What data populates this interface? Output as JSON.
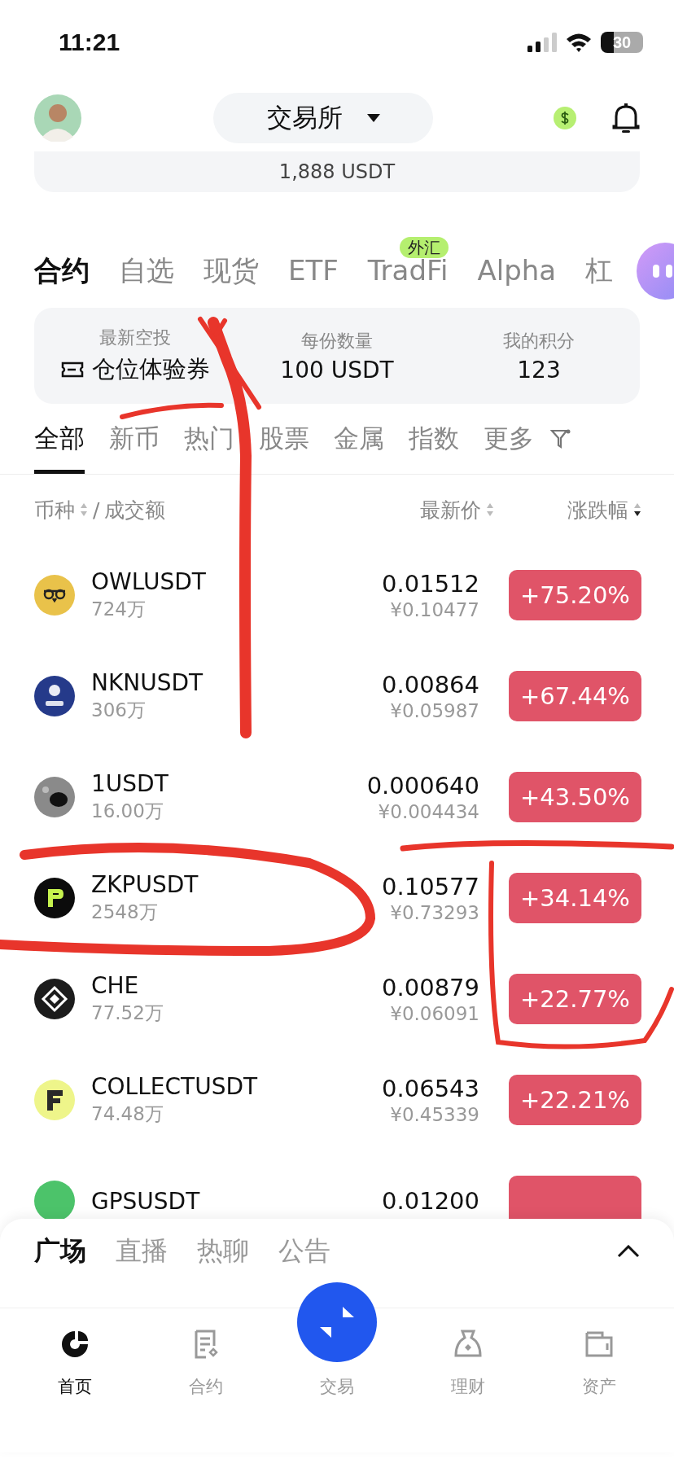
{
  "status_bar": {
    "time": "11:21",
    "battery": "30"
  },
  "header": {
    "exchange_selector": "交易所"
  },
  "balance_card": {
    "text": "1,888 USDT"
  },
  "market_tabs": [
    {
      "label": "合约",
      "selected": true
    },
    {
      "label": "自选",
      "selected": false
    },
    {
      "label": "现货",
      "selected": false
    },
    {
      "label": "ETF",
      "selected": false
    },
    {
      "label": "TradFi",
      "selected": false,
      "badge": "外汇"
    },
    {
      "label": "Alpha",
      "selected": false
    },
    {
      "label": "杠",
      "selected": false
    }
  ],
  "airdrop": [
    {
      "label": "最新空投",
      "value": "仓位体验券",
      "kind": "ticket"
    },
    {
      "label": "每份数量",
      "value": "100 USDT",
      "kind": "plain"
    },
    {
      "label": "我的积分",
      "value": "123",
      "kind": "plain"
    }
  ],
  "categories": [
    {
      "label": "全部",
      "selected": true
    },
    {
      "label": "新币",
      "selected": false
    },
    {
      "label": "热门",
      "selected": false
    },
    {
      "label": "股票",
      "selected": false
    },
    {
      "label": "金属",
      "selected": false
    },
    {
      "label": "指数",
      "selected": false
    },
    {
      "label": "更多",
      "selected": false
    }
  ],
  "column_header": {
    "pair": {
      "label": "币种",
      "active": false
    },
    "separator": "/",
    "volume": "成交额",
    "price": {
      "label": "最新价",
      "active": false
    },
    "change": {
      "label": "涨跌幅",
      "active": true
    }
  },
  "rows": [
    {
      "name": "OWLUSDT",
      "volume": "724万",
      "price": "0.01512",
      "price_cny": "¥0.10477",
      "change": "+75.20%"
    },
    {
      "name": "NKNUSDT",
      "volume": "306万",
      "price": "0.00864",
      "price_cny": "¥0.05987",
      "change": "+67.44%"
    },
    {
      "name": "1USDT",
      "volume": "16.00万",
      "price": "0.000640",
      "price_cny": "¥0.004434",
      "change": "+43.50%"
    },
    {
      "name": "ZKPUSDT",
      "volume": "2548万",
      "price": "0.10577",
      "price_cny": "¥0.73293",
      "change": "+34.14%"
    },
    {
      "name": "CHE",
      "volume": "77.52万",
      "price": "0.00879",
      "price_cny": "¥0.06091",
      "change": "+22.77%"
    },
    {
      "name": "COLLECTUSDT",
      "volume": "74.48万",
      "price": "0.06543",
      "price_cny": "¥0.45339",
      "change": "+22.21%"
    },
    {
      "name": "GPSUSDT",
      "price": "0.01200"
    }
  ],
  "feed_tabs": [
    {
      "label": "广场",
      "selected": true
    },
    {
      "label": "直播",
      "selected": false
    },
    {
      "label": "热聊",
      "selected": false
    },
    {
      "label": "公告",
      "selected": false
    }
  ],
  "nav": [
    {
      "label": "首页",
      "kind": "tab",
      "selected": true
    },
    {
      "label": "合约",
      "kind": "tab",
      "selected": false
    },
    {
      "label": "交易",
      "kind": "center",
      "selected": false
    },
    {
      "label": "理财",
      "kind": "tab",
      "selected": false
    },
    {
      "label": "资产",
      "kind": "tab",
      "selected": false
    }
  ]
}
